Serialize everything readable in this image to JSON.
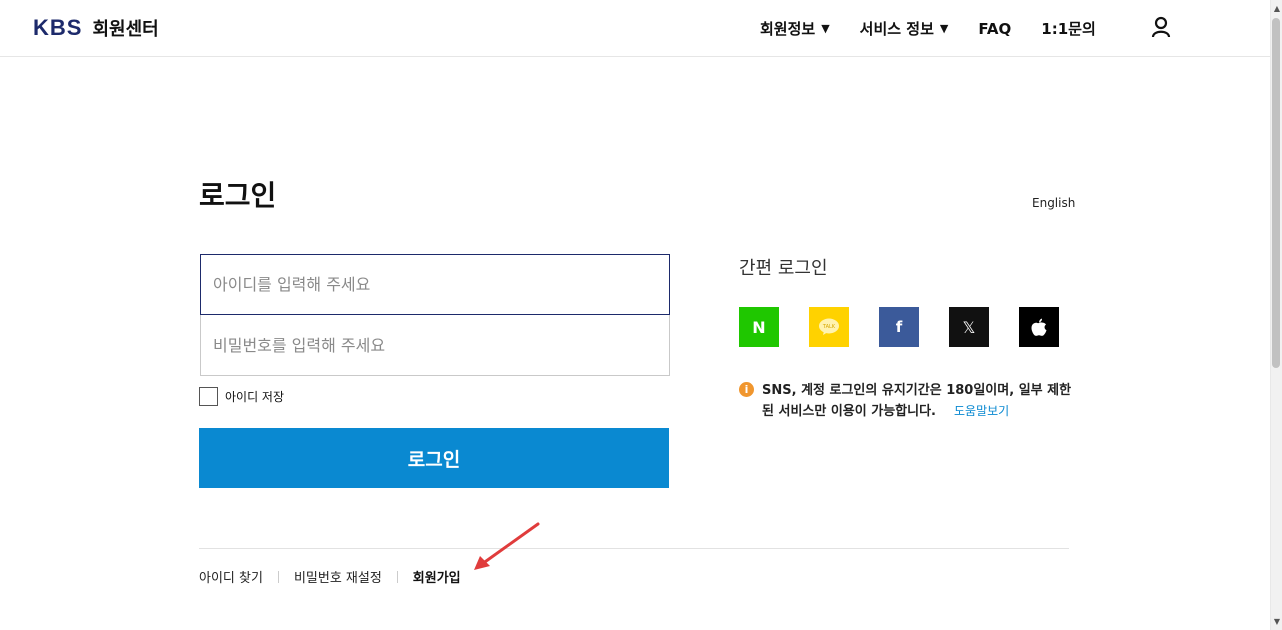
{
  "header": {
    "logo_kbs": "KBS",
    "logo_title": "회원센터",
    "nav": [
      {
        "label": "회원정보",
        "has_dropdown": true
      },
      {
        "label": "서비스 정보",
        "has_dropdown": true
      },
      {
        "label": "FAQ",
        "has_dropdown": false
      },
      {
        "label": "1:1문의",
        "has_dropdown": false
      }
    ],
    "user_icon": "user-icon"
  },
  "main": {
    "title": "로그인",
    "language_link": "English",
    "id_placeholder": "아이디를 입력해 주세요",
    "password_placeholder": "비밀번호를 입력해 주세요",
    "remember_label": "아이디 저장",
    "login_button": "로그인"
  },
  "sns": {
    "title": "간편 로그인",
    "providers": [
      "naver",
      "kakao",
      "facebook",
      "x",
      "apple"
    ],
    "naver_glyph": "N",
    "facebook_glyph": "f",
    "x_glyph": "𝕏",
    "notice": "SNS, 계정 로그인의 유지기간은 180일이며, 일부 제한된 서비스만 이용이 가능합니다.",
    "help_link": "도움말보기"
  },
  "footer_links": {
    "find_id": "아이디 찾기",
    "reset_password": "비밀번호 재설정",
    "signup": "회원가입"
  },
  "colors": {
    "brand": "#1d2a6b",
    "login_button": "#0a89d1",
    "naver": "#1fc700",
    "kakao": "#ffd200",
    "facebook": "#3b5a9a",
    "annotation_arrow": "#e03c3c"
  }
}
